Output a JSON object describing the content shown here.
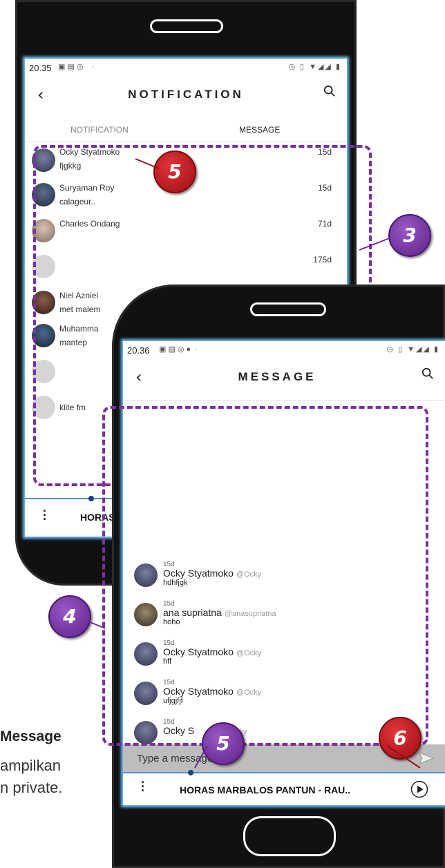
{
  "back_screen": {
    "status_time": "20.35",
    "title": "NOTIFICATION",
    "tabs": [
      "NOTIFICATION",
      "MESSAGE"
    ],
    "conversations": [
      {
        "name": "Ocky Styatmoko",
        "preview": "fjgkkg",
        "time": "15d"
      },
      {
        "name": "Suryaman Roy",
        "preview": "calageur..",
        "time": "15d"
      },
      {
        "name": "Charles Ondang",
        "preview": "",
        "time": "71d"
      },
      {
        "name": "",
        "preview": "",
        "time": "175d"
      },
      {
        "name": "Niel Azniel",
        "preview": "met malem",
        "time": ""
      },
      {
        "name": "Muhamma",
        "preview": "mantep",
        "time": ""
      },
      {
        "name": "",
        "preview": "",
        "time": ""
      },
      {
        "name": "klite fm",
        "preview": "",
        "time": ""
      }
    ],
    "player_title": "HORAS"
  },
  "front_screen": {
    "status_time": "20.36",
    "title": "MESSAGE",
    "messages": [
      {
        "time": "15d",
        "name": "Ocky Styatmoko",
        "handle": "@Ocky",
        "text": "hdhfjgk"
      },
      {
        "time": "15d",
        "name": "ana supriatna",
        "handle": "@anasupriatna",
        "text": "hoho"
      },
      {
        "time": "15d",
        "name": "Ocky Styatmoko",
        "handle": "@Ocky",
        "text": "hff"
      },
      {
        "time": "15d",
        "name": "Ocky Styatmoko",
        "handle": "@Ocky",
        "text": "ufjgjfjf"
      },
      {
        "time": "15d",
        "name": "Ocky S",
        "handle": "@Ocky",
        "text": ""
      }
    ],
    "input_placeholder": "Type a message...",
    "player_title": "HORAS MARBALOS PANTUN - RAU.."
  },
  "badges": [
    "5",
    "3",
    "4",
    "5",
    "6"
  ],
  "side_text": {
    "heading": "Message",
    "line1": "ampilkan",
    "line2": "n private."
  },
  "colors": {
    "accent_purple": "#7b2fa0",
    "badge_red": "#c0151b",
    "screen_glow": "#6ec3ff"
  }
}
